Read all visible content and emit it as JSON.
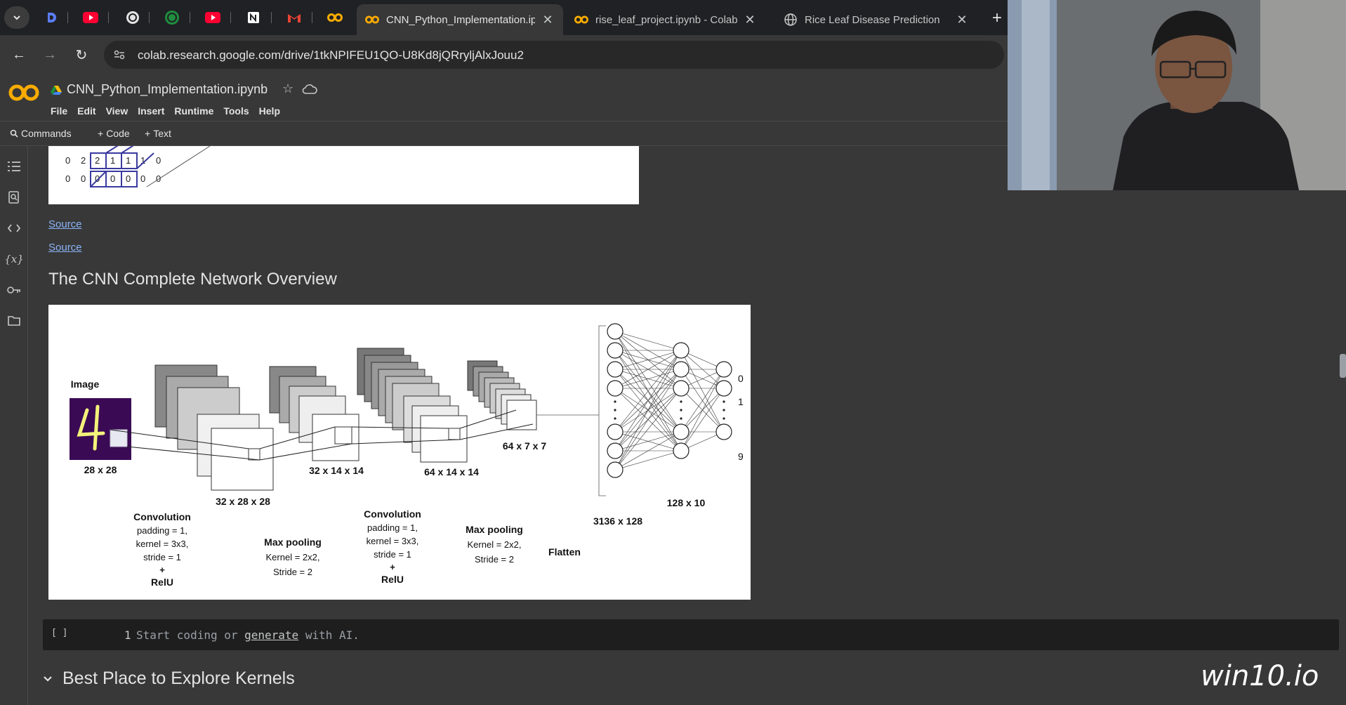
{
  "browser": {
    "tabs": [
      {
        "title": "CNN_Python_Implementation.ipynb",
        "active": true
      },
      {
        "title": "rise_leaf_project.ipynb - Colab",
        "active": false
      },
      {
        "title": "Rice Leaf Disease Prediction",
        "active": false
      }
    ],
    "url": "colab.research.google.com/drive/1tkNPIFEU1QO-U8Kd8jQRryljAlxJouu2"
  },
  "colab": {
    "notebook_title": "CNN_Python_Implementation.ipynb",
    "menu": [
      "File",
      "Edit",
      "View",
      "Insert",
      "Runtime",
      "Tools",
      "Help"
    ],
    "toolbar": {
      "commands": "Commands",
      "code": "Code",
      "text": "Text"
    }
  },
  "matrix": {
    "rows": [
      [
        "0",
        "2",
        "2",
        "1",
        "1",
        "1",
        "0"
      ],
      [
        "0",
        "0",
        "0",
        "0",
        "0",
        "0",
        "0"
      ]
    ]
  },
  "content": {
    "source_links": [
      "Source",
      "Source"
    ],
    "section_heading": "The CNN Complete Network Overview",
    "code_cell": {
      "run_label": "[ ]",
      "line_number": "1",
      "placeholder_pre": "Start coding or ",
      "placeholder_link": "generate",
      "placeholder_post": " with AI."
    },
    "next_section": "Best Place to Explore Kernels"
  },
  "diagram": {
    "image_label": "Image",
    "input_dim": "28 x 28",
    "conv1_dim": "32 x 28 x 28",
    "pool1_dim": "32 x 14 x 14",
    "conv2_dim": "64 x 14 x 14",
    "pool2_dim": "64 x 7 x 7",
    "fc1_dim": "3136 x 128",
    "fc2_dim": "128 x 10",
    "outputs": [
      "0",
      "1",
      "9"
    ],
    "conv1": {
      "title": "Convolution",
      "l1": "padding = 1,",
      "l2": "kernel = 3x3,",
      "l3": "stride = 1",
      "plus": "+",
      "act": "RelU"
    },
    "pool1": {
      "title": "Max pooling",
      "l1": "Kernel = 2x2,",
      "l2": "Stride = 2"
    },
    "conv2": {
      "title": "Convolution",
      "l1": "padding = 1,",
      "l2": "kernel = 3x3,",
      "l3": "stride = 1",
      "plus": "+",
      "act": "RelU"
    },
    "pool2": {
      "title": "Max pooling",
      "l1": "Kernel = 2x2,",
      "l2": "Stride = 2"
    },
    "flatten": "Flatten"
  },
  "overlay": {
    "watermark": "win10.io"
  },
  "colors": {
    "tabstrip": "#202124",
    "page": "#383838",
    "code_bg": "#1e1e1e",
    "link": "#8ab4f8",
    "colab_orange": "#f9ab00",
    "matrix_grid": "#3a3aa0"
  }
}
